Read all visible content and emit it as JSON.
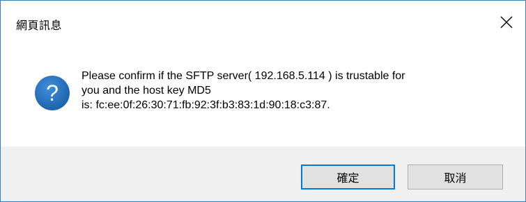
{
  "dialog": {
    "title": "網頁訊息",
    "close_icon": "close-icon",
    "question_icon": "question-icon"
  },
  "message": {
    "line1": "Please confirm if the SFTP server( 192.168.5.114 ) is trustable for",
    "line2": "you and the host key MD5",
    "line3": "is: fc:ee:0f:26:30:71:fb:92:3f:b3:83:1d:90:18:c3:87."
  },
  "buttons": {
    "ok_label": "確定",
    "cancel_label": "取消"
  },
  "colors": {
    "accent": "#0078d7",
    "icon_blue": "#1b5fa8",
    "footer_bg": "#f0f0f0"
  }
}
